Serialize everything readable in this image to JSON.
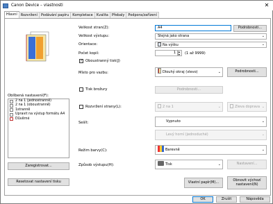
{
  "window": {
    "title": "Canon Device – vlastnosti",
    "close": "✕"
  },
  "tabs": [
    "Hlavní",
    "Rozvržení",
    "Podávání papíru",
    "Kompletace",
    "Kvalita",
    "Přebaly",
    "Podpora/zařízení"
  ],
  "left": {
    "favorites_label": "Oblíbená nastavení(F):",
    "favorites": [
      "2 na 1 (jednostranně)",
      "2 na 1 (oboustranně)",
      "1stranně",
      "Upravit na výstup formátu A4",
      "Důvěrné"
    ],
    "register_btn": "Zaregistrovat...",
    "reset_btn": "Resetovat nastavení tisku"
  },
  "fields": {
    "page_size_label": "Velikost stran(Z):",
    "page_size_value": "A4",
    "details_btn_1": "Podrobnosti...",
    "output_size_label": "Velikost výstupu:",
    "output_size_value": "Stejná jako strana",
    "orientation_label": "Orientace:",
    "orientation_value": "Na výšku",
    "copies_label": "Počet kopií:",
    "copies_value": "1",
    "copies_range": "(1 až 9999)",
    "duplex_label": "Oboustranný tisk(J)",
    "duplex_checked": true,
    "binding_label": "Místo pro vazbu:",
    "binding_value": "Dlouhý okraj (vlevo)",
    "details_btn_2": "Podrobnosti...",
    "booklet_label": "Tisk brožury",
    "booklet_details_btn": "Podrobnosti...",
    "layout_label": "Rozvržení strany(L):",
    "layout_value": "2 na 1",
    "layout_order_value": "Zleva doprava",
    "staple_label": "Sešít:",
    "staple_value": "Vypnuto",
    "staple_pos_value": "Levý horní (jednoduché)",
    "color_label": "Režim barvy(C):",
    "color_value": "Barevně",
    "output_method_label": "Způsob výstupu(H):",
    "output_method_value": "Tisk",
    "output_settings_btn": "Nastavení...",
    "custom_paper_btn": "Vlastní papír(M)...",
    "restore_defaults_btn": "Obnovit výchozí nastavení(N)"
  },
  "footer": {
    "ok": "OK",
    "cancel": "Zrušit",
    "help": "Nápověda"
  },
  "colors": {
    "accent": "#0078d7",
    "paper_blue": "#3a6fd8",
    "paper_orange": "#f0a030"
  }
}
